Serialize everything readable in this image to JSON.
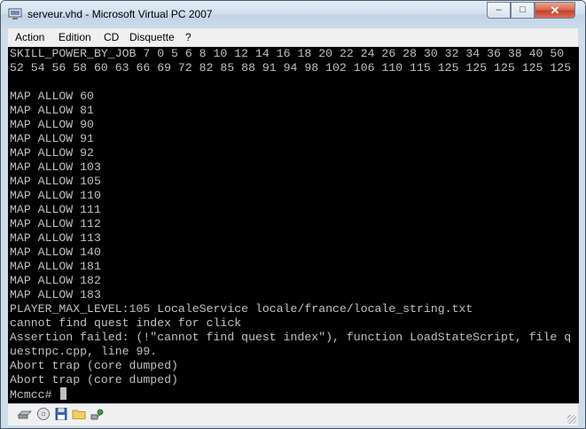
{
  "window": {
    "title": "serveur.vhd - Microsoft Virtual PC 2007",
    "controls": {
      "minimize": "–",
      "maximize": "□",
      "close": "✕"
    }
  },
  "menu": [
    "Action",
    "Edition",
    "CD",
    "Disquette",
    "?"
  ],
  "console": {
    "lines": [
      "SKILL_POWER_BY_JOB 7 0 5 6 8 10 12 14 16 18 20 22 24 26 28 30 32 34 36 38 40 50",
      "52 54 56 58 60 63 66 69 72 82 85 88 91 94 98 102 106 110 115 125 125 125 125 125",
      "",
      "MAP ALLOW 60",
      "MAP ALLOW 81",
      "MAP ALLOW 90",
      "MAP ALLOW 91",
      "MAP ALLOW 92",
      "MAP ALLOW 103",
      "MAP ALLOW 105",
      "MAP ALLOW 110",
      "MAP ALLOW 111",
      "MAP ALLOW 112",
      "MAP ALLOW 113",
      "MAP ALLOW 140",
      "MAP ALLOW 181",
      "MAP ALLOW 182",
      "MAP ALLOW 183",
      "PLAYER_MAX_LEVEL:105 LocaleService locale/france/locale_string.txt",
      "cannot find quest index for click",
      "Assertion failed: (!\"cannot find quest index\"), function LoadStateScript, file q",
      "uestnpc.cpp, line 99.",
      "Abort trap (core dumped)",
      "Abort trap (core dumped)"
    ],
    "prompt": "Mcmcc# "
  },
  "statusbar": {
    "icons": [
      "hard-disk-icon",
      "cd-drive-icon",
      "floppy-disk-icon",
      "shared-folder-icon",
      "network-icon"
    ]
  },
  "colors": {
    "console_bg": "#000000",
    "console_fg": "#c0c0c0",
    "titlebar": "#d3e1ef",
    "close_button": "#c4412a"
  }
}
